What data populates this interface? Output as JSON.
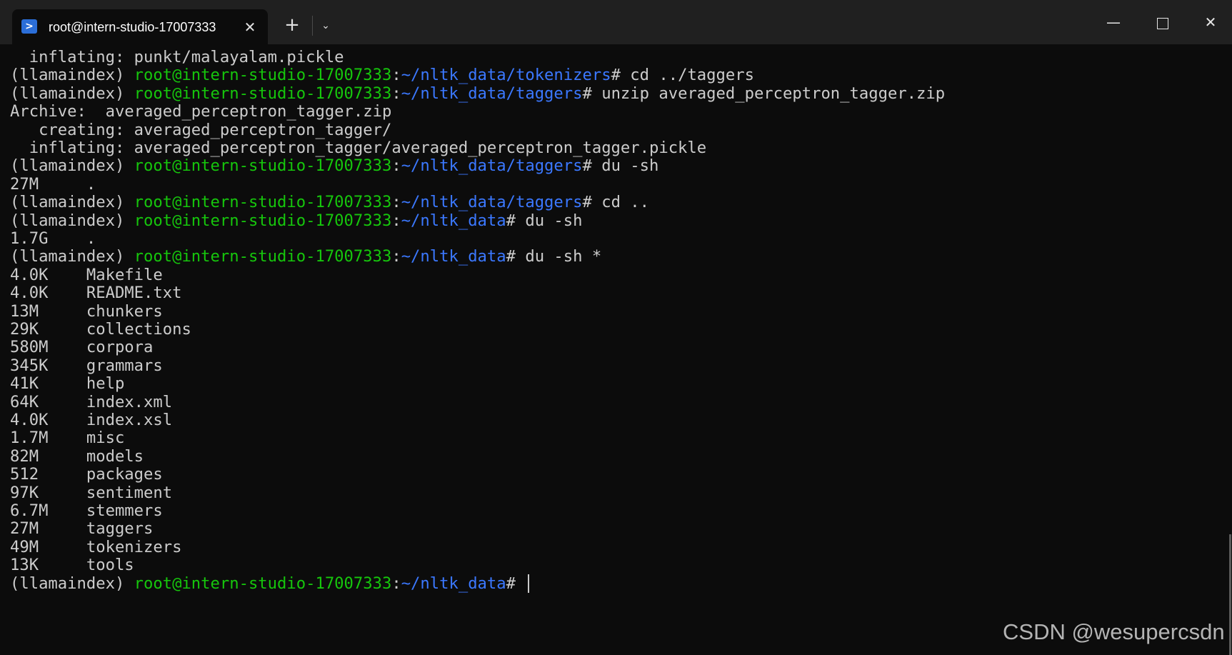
{
  "tab": {
    "icon": "powershell-icon",
    "title": "root@intern-studio-17007333",
    "close_glyph": "✕"
  },
  "toolbar": {
    "new_tab_glyph": "+",
    "dropdown_glyph": "⌄"
  },
  "window_controls": {
    "minimize_glyph": "—",
    "close_glyph": "✕"
  },
  "terminal": {
    "env": "(llamaindex) ",
    "user_host": "root@intern-studio-17007333",
    "colors": {
      "background": "#0c0c0c",
      "text": "#cccccc",
      "user": "#16c60c",
      "path": "#3b78ff"
    },
    "lines": [
      {
        "kind": "output",
        "text": "  inflating: punkt/malayalam.pickle"
      },
      {
        "kind": "prompt",
        "path": "~/nltk_data/tokenizers",
        "cmd": "# cd ../taggers"
      },
      {
        "kind": "prompt",
        "path": "~/nltk_data/taggers",
        "cmd": "# unzip averaged_perceptron_tagger.zip"
      },
      {
        "kind": "output",
        "text": "Archive:  averaged_perceptron_tagger.zip"
      },
      {
        "kind": "output",
        "text": "   creating: averaged_perceptron_tagger/"
      },
      {
        "kind": "output",
        "text": "  inflating: averaged_perceptron_tagger/averaged_perceptron_tagger.pickle"
      },
      {
        "kind": "prompt",
        "path": "~/nltk_data/taggers",
        "cmd": "# du -sh"
      },
      {
        "kind": "output",
        "text": "27M     ."
      },
      {
        "kind": "prompt",
        "path": "~/nltk_data/taggers",
        "cmd": "# cd .."
      },
      {
        "kind": "prompt",
        "path": "~/nltk_data",
        "cmd": "# du -sh"
      },
      {
        "kind": "output",
        "text": "1.7G    ."
      },
      {
        "kind": "prompt",
        "path": "~/nltk_data",
        "cmd": "# du -sh *"
      },
      {
        "kind": "output",
        "text": "4.0K    Makefile"
      },
      {
        "kind": "output",
        "text": "4.0K    README.txt"
      },
      {
        "kind": "output",
        "text": "13M     chunkers"
      },
      {
        "kind": "output",
        "text": "29K     collections"
      },
      {
        "kind": "output",
        "text": "580M    corpora"
      },
      {
        "kind": "output",
        "text": "345K    grammars"
      },
      {
        "kind": "output",
        "text": "41K     help"
      },
      {
        "kind": "output",
        "text": "64K     index.xml"
      },
      {
        "kind": "output",
        "text": "4.0K    index.xsl"
      },
      {
        "kind": "output",
        "text": "1.7M    misc"
      },
      {
        "kind": "output",
        "text": "82M     models"
      },
      {
        "kind": "output",
        "text": "512     packages"
      },
      {
        "kind": "output",
        "text": "97K     sentiment"
      },
      {
        "kind": "output",
        "text": "6.7M    stemmers"
      },
      {
        "kind": "output",
        "text": "27M     taggers"
      },
      {
        "kind": "output",
        "text": "49M     tokenizers"
      },
      {
        "kind": "output",
        "text": "13K     tools"
      },
      {
        "kind": "prompt",
        "path": "~/nltk_data",
        "cmd": "# ",
        "cursor": true
      }
    ]
  },
  "watermark": "CSDN @wesupercsdn"
}
